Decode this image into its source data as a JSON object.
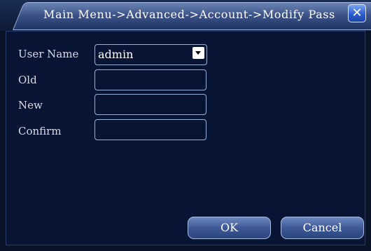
{
  "window": {
    "title": "Main Menu->Advanced->Account->Modify Pass",
    "close_icon": "close-icon"
  },
  "form": {
    "user_name_label": "User Name",
    "user_name_value": "admin",
    "old_label": "Old",
    "old_value": "",
    "new_label": "New",
    "new_value": "",
    "confirm_label": "Confirm",
    "confirm_value": ""
  },
  "buttons": {
    "ok_label": "OK",
    "cancel_label": "Cancel"
  },
  "colors": {
    "background": "#081433",
    "accent": "#2c5ed0"
  }
}
